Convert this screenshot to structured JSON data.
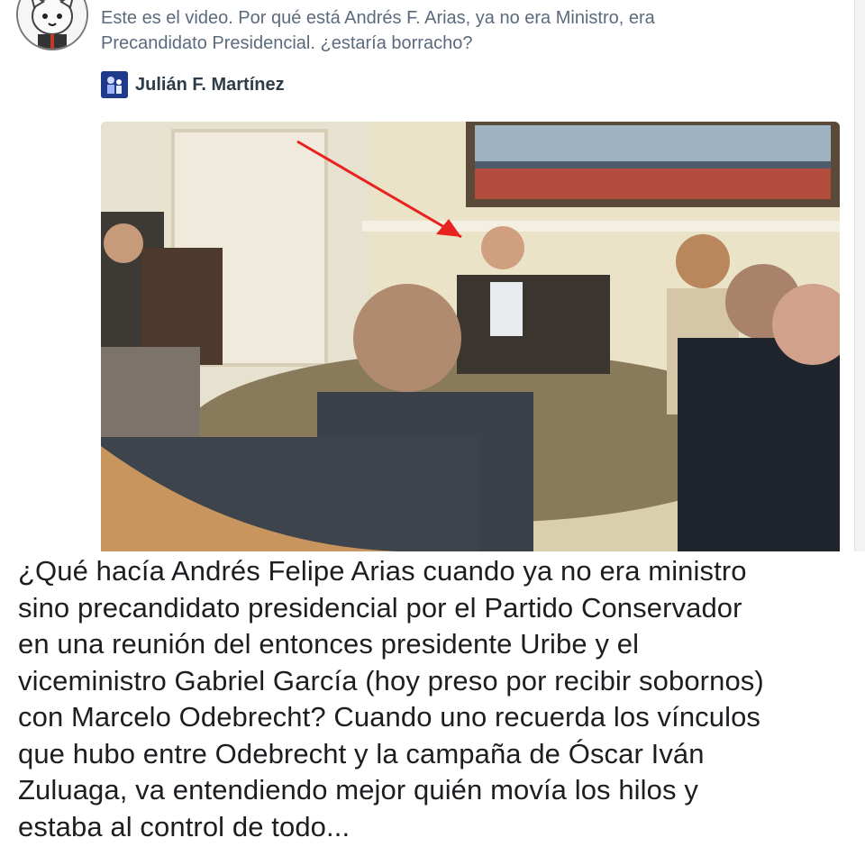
{
  "post": {
    "text_lines": [
      "Este es el video. Por qué está Andrés F. Arias, ya no era Ministro, era",
      "Precandidato Presidencial. ¿estaría borracho?"
    ],
    "author": {
      "name": "Julián F. Martínez",
      "icon": "author-avatar-icon"
    },
    "avatar_icon": "profile-avatar-icon",
    "video": {
      "icon": "video-thumbnail",
      "annotation": "red-arrow"
    }
  },
  "caption": {
    "lines": [
      "¿Qué hacía Andrés Felipe Arias cuando ya no era ministro",
      "sino precandidato presidencial por el Partido Conservador",
      "en una reunión del entonces presidente Uribe y el",
      "viceministro Gabriel García (hoy preso por recibir sobornos)",
      "con Marcelo Odebrecht? Cuando uno recuerda los vínculos",
      "que hubo entre Odebrecht y la campaña de Óscar Iván",
      "Zuluaga,  va entendiendo mejor quién movía los hilos y",
      "estaba al control de todo..."
    ]
  },
  "colors": {
    "post_text": "#5b6b7d",
    "author_name": "#2d3c48",
    "caption_text": "#1c1e21",
    "annotation_arrow": "#e8231f",
    "background": "#f2f3f5"
  }
}
